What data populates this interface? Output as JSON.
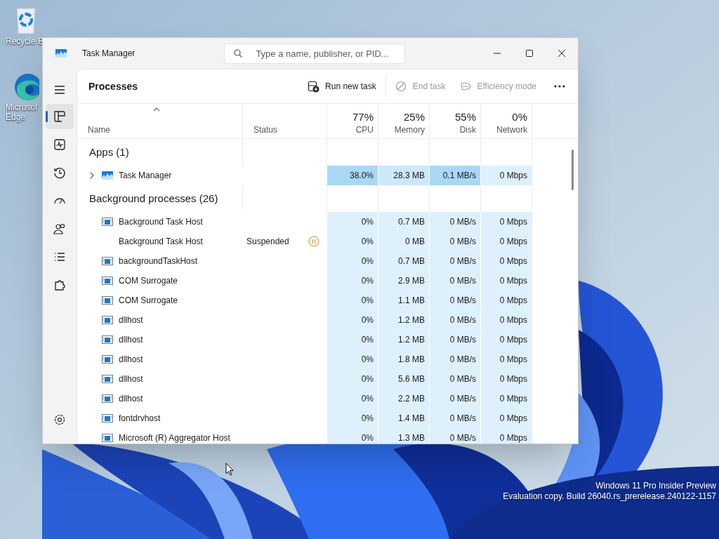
{
  "desktop": {
    "icons": [
      {
        "kind": "recycle",
        "lines": [
          "Recycle B"
        ]
      },
      {
        "kind": "edge",
        "lines": [
          "Microsof",
          "Edge"
        ]
      }
    ],
    "watermark": [
      "Windows 11 Pro Insider Preview",
      "Evaluation copy. Build 26040.rs_prerelease.240122-1157"
    ]
  },
  "window": {
    "title": "Task Manager",
    "search": {
      "placeholder": "Type a name, publisher, or PID..."
    }
  },
  "nav": [
    {
      "kind": "processes",
      "selected": true
    },
    {
      "kind": "performance",
      "selected": false
    },
    {
      "kind": "history",
      "selected": false
    },
    {
      "kind": "startup",
      "selected": false
    },
    {
      "kind": "users",
      "selected": false
    },
    {
      "kind": "details",
      "selected": false
    },
    {
      "kind": "services",
      "selected": false
    }
  ],
  "page_title": "Processes",
  "toolbar": [
    {
      "kind": "run",
      "label": "Run new task",
      "disabled": false
    },
    {
      "kind": "end",
      "label": "End task",
      "disabled": true
    },
    {
      "kind": "efficiency",
      "label": "Efficiency mode",
      "disabled": true
    }
  ],
  "columns": [
    {
      "label": "Name",
      "sorted": true
    },
    {
      "label": "Status"
    },
    {
      "label": "CPU",
      "percent": "77%"
    },
    {
      "label": "Memory",
      "percent": "25%"
    },
    {
      "label": "Disk",
      "percent": "55%"
    },
    {
      "label": "Network",
      "percent": "0%"
    }
  ],
  "groups": [
    {
      "title": "Apps (1)",
      "rows": [
        {
          "name": "Task Manager",
          "kind": "app",
          "expanded": false,
          "cells": [
            {
              "text": "38.0%",
              "color": "#a9d8f6"
            },
            {
              "text": "28.3 MB",
              "color": "#cde8fb"
            },
            {
              "text": "0.1 MB/s",
              "color": "#a9d8f6"
            },
            {
              "text": "0 Mbps",
              "color": "#def0fc"
            }
          ]
        }
      ]
    },
    {
      "title": "Background processes (26)",
      "rows": [
        {
          "name": "Background Task Host",
          "kind": "process",
          "cells": [
            {
              "text": "0%",
              "color": "#def0fc"
            },
            {
              "text": "0.7 MB",
              "color": "#def0fc"
            },
            {
              "text": "0 MB/s",
              "color": "#def0fc"
            },
            {
              "text": "0 Mbps",
              "color": "#def0fc"
            }
          ]
        },
        {
          "name": "Background Task Host",
          "kind": "none",
          "status": "Suspended",
          "suspended": true,
          "cells": [
            {
              "text": "0%",
              "color": "#def0fc"
            },
            {
              "text": "0 MB",
              "color": "#def0fc"
            },
            {
              "text": "0 MB/s",
              "color": "#def0fc"
            },
            {
              "text": "0 Mbps",
              "color": "#def0fc"
            }
          ]
        },
        {
          "name": "backgroundTaskHost",
          "kind": "process",
          "cells": [
            {
              "text": "0%",
              "color": "#def0fc"
            },
            {
              "text": "0.7 MB",
              "color": "#def0fc"
            },
            {
              "text": "0 MB/s",
              "color": "#def0fc"
            },
            {
              "text": "0 Mbps",
              "color": "#def0fc"
            }
          ]
        },
        {
          "name": "COM Surrogate",
          "kind": "process",
          "cells": [
            {
              "text": "0%",
              "color": "#def0fc"
            },
            {
              "text": "2.9 MB",
              "color": "#def0fc"
            },
            {
              "text": "0 MB/s",
              "color": "#def0fc"
            },
            {
              "text": "0 Mbps",
              "color": "#def0fc"
            }
          ]
        },
        {
          "name": "COM Surrogate",
          "kind": "process",
          "cells": [
            {
              "text": "0%",
              "color": "#def0fc"
            },
            {
              "text": "1.1 MB",
              "color": "#def0fc"
            },
            {
              "text": "0 MB/s",
              "color": "#def0fc"
            },
            {
              "text": "0 Mbps",
              "color": "#def0fc"
            }
          ]
        },
        {
          "name": "dllhost",
          "kind": "process",
          "cells": [
            {
              "text": "0%",
              "color": "#def0fc"
            },
            {
              "text": "1.2 MB",
              "color": "#def0fc"
            },
            {
              "text": "0 MB/s",
              "color": "#def0fc"
            },
            {
              "text": "0 Mbps",
              "color": "#def0fc"
            }
          ]
        },
        {
          "name": "dllhost",
          "kind": "process",
          "cells": [
            {
              "text": "0%",
              "color": "#def0fc"
            },
            {
              "text": "1.2 MB",
              "color": "#def0fc"
            },
            {
              "text": "0 MB/s",
              "color": "#def0fc"
            },
            {
              "text": "0 Mbps",
              "color": "#def0fc"
            }
          ]
        },
        {
          "name": "dllhost",
          "kind": "process",
          "cells": [
            {
              "text": "0%",
              "color": "#def0fc"
            },
            {
              "text": "1.8 MB",
              "color": "#def0fc"
            },
            {
              "text": "0 MB/s",
              "color": "#def0fc"
            },
            {
              "text": "0 Mbps",
              "color": "#def0fc"
            }
          ]
        },
        {
          "name": "dllhost",
          "kind": "process",
          "cells": [
            {
              "text": "0%",
              "color": "#def0fc"
            },
            {
              "text": "5.6 MB",
              "color": "#def0fc"
            },
            {
              "text": "0 MB/s",
              "color": "#def0fc"
            },
            {
              "text": "0 Mbps",
              "color": "#def0fc"
            }
          ]
        },
        {
          "name": "dllhost",
          "kind": "process",
          "cells": [
            {
              "text": "0%",
              "color": "#def0fc"
            },
            {
              "text": "2.2 MB",
              "color": "#def0fc"
            },
            {
              "text": "0 MB/s",
              "color": "#def0fc"
            },
            {
              "text": "0 Mbps",
              "color": "#def0fc"
            }
          ]
        },
        {
          "name": "fontdrvhost",
          "kind": "process",
          "cells": [
            {
              "text": "0%",
              "color": "#def0fc"
            },
            {
              "text": "1.4 MB",
              "color": "#def0fc"
            },
            {
              "text": "0 MB/s",
              "color": "#def0fc"
            },
            {
              "text": "0 Mbps",
              "color": "#def0fc"
            }
          ]
        },
        {
          "name": "Microsoft (R) Aggregator Host",
          "kind": "process",
          "cells": [
            {
              "text": "0%",
              "color": "#def0fc"
            },
            {
              "text": "1.3 MB",
              "color": "#def0fc"
            },
            {
              "text": "0 MB/s",
              "color": "#def0fc"
            },
            {
              "text": "0 Mbps",
              "color": "#def0fc"
            }
          ]
        }
      ]
    }
  ]
}
